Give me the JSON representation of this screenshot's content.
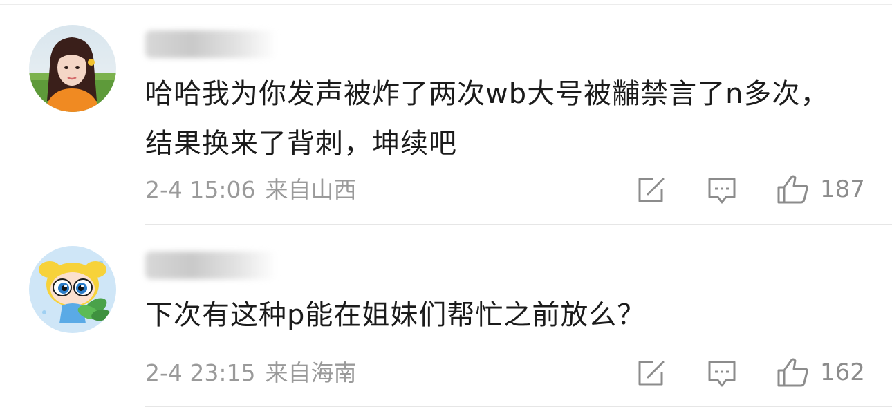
{
  "comments": [
    {
      "username": "",
      "text": "哈哈我为你发声被炸了两次wb大号被黼禁言了n多次，结果换来了背刺，坤续吧",
      "time": "2-4 15:06",
      "location": "来自山西",
      "likes": "187",
      "icons": {
        "share": "share-icon",
        "reply": "comment-icon",
        "like": "thumbs-up-icon"
      }
    },
    {
      "username": "",
      "text": "下次有这种p能在姐妹们帮忙之前放么？",
      "time": "2-4 23:15",
      "location": "来自海南",
      "likes": "162",
      "icons": {
        "share": "share-icon",
        "reply": "comment-icon",
        "like": "thumbs-up-icon"
      }
    }
  ]
}
